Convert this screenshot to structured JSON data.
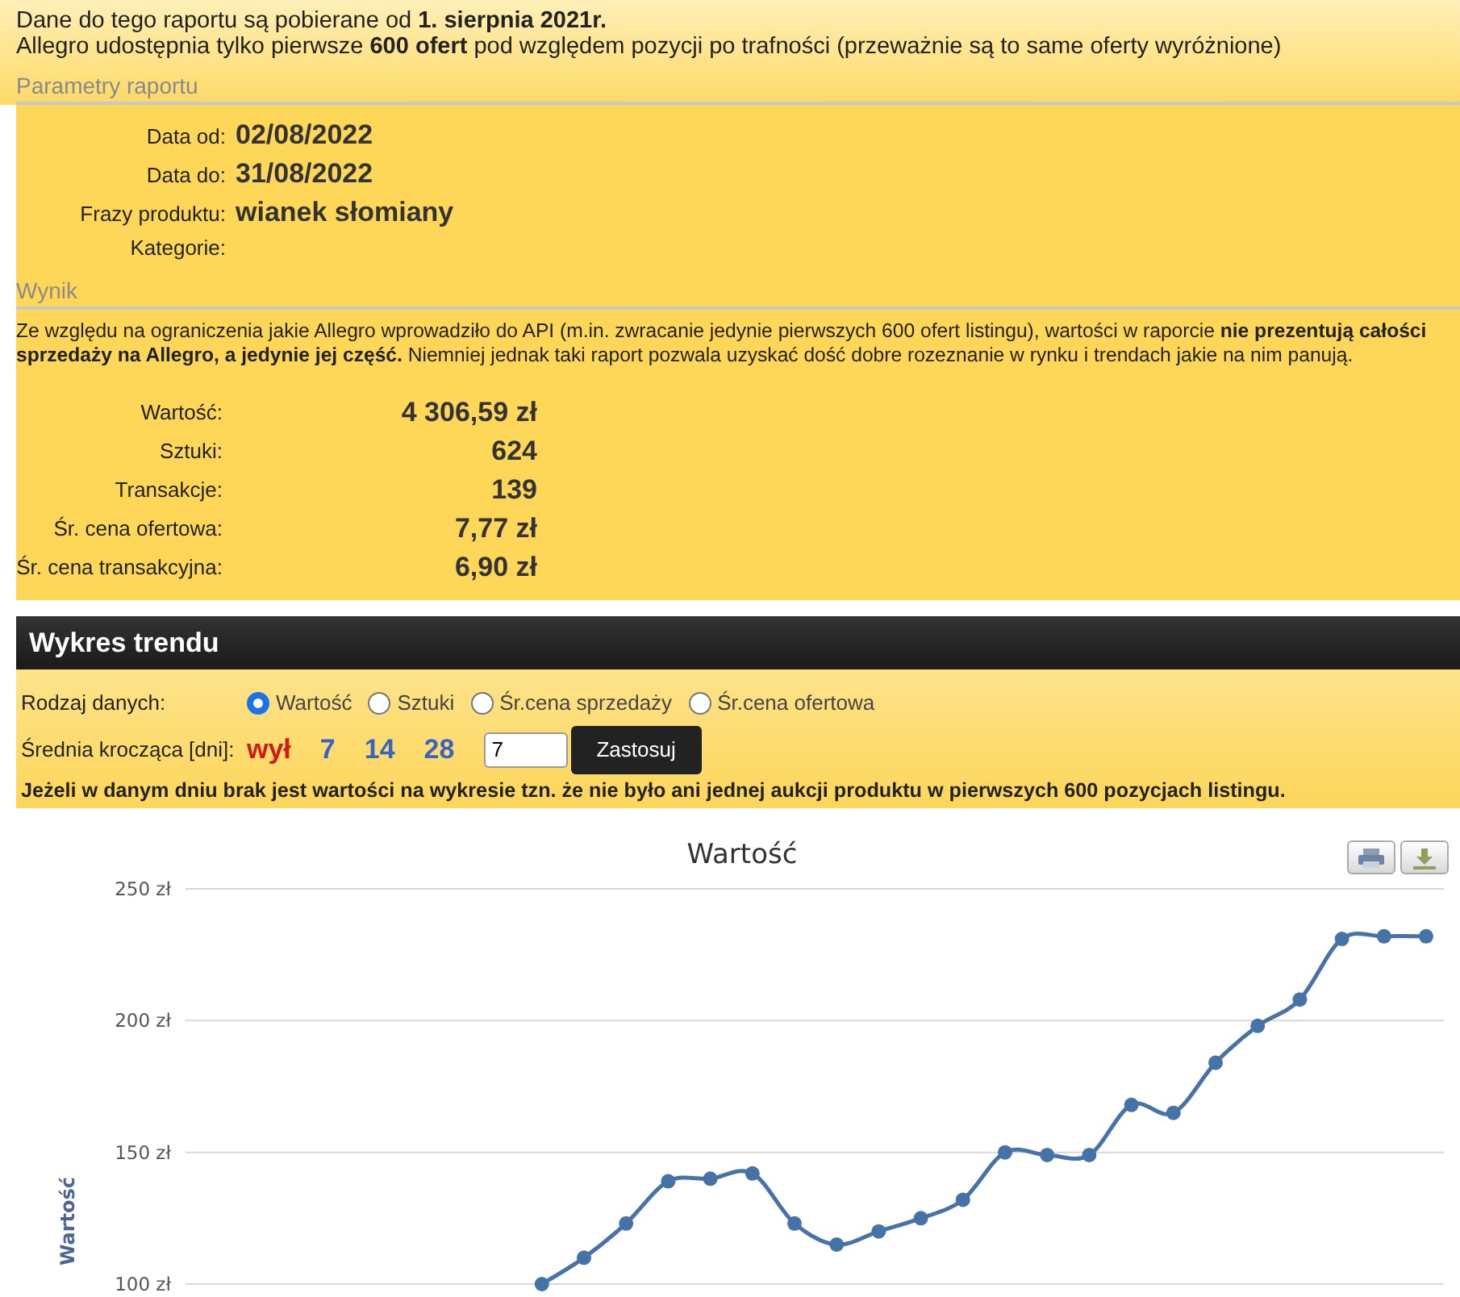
{
  "intro": {
    "lines": [
      "Dane do tego raportu są pobierane od **1. sierpnia 2021r.**",
      "Allegro udostępnia tylko pierwsze **600 ofert** pod względem pozycji po trafności (przeważnie są to same oferty wyróżnione)"
    ]
  },
  "parameters": {
    "heading": "Parametry raportu",
    "rows": [
      {
        "label": "Data od:",
        "value": "02/08/2022"
      },
      {
        "label": "Data do:",
        "value": "31/08/2022"
      },
      {
        "label": "Frazy produktu:",
        "value": "wianek słomiany"
      },
      {
        "label": "Kategorie:"
      }
    ]
  },
  "result": {
    "heading": "Wynik",
    "note": "Ze względu na ograniczenia jakie Allegro wprowadziło do API (m.in. zwracanie jedynie pierwszych 600 ofert listingu), wartości w raporcie **nie prezentują całości sprzedaży na Allegro, a jedynie jej część.** Niemniej jednak taki raport pozwala uzyskać dość dobre rozeznanie w rynku i trendach jakie na nim panują.",
    "stats": [
      {
        "label": "Wartość:",
        "value": "4 306,59 zł"
      },
      {
        "label": "Sztuki:",
        "value": "624"
      },
      {
        "label": "Transakcje:",
        "value": "139"
      },
      {
        "label": "Śr. cena ofertowa:",
        "value": "7,77 zł"
      },
      {
        "label": "Śr. cena transakcyjna:",
        "value": "6,90 zł"
      }
    ]
  },
  "trend": {
    "title": "Wykres trendu",
    "data_type": {
      "label": "Rodzaj danych:",
      "options": [
        {
          "label": "Wartość",
          "selected": true
        },
        {
          "label": "Sztuki",
          "selected": false
        },
        {
          "label": "Śr.cena sprzedaży",
          "selected": false
        },
        {
          "label": "Śr.cena ofertowa",
          "selected": false
        }
      ]
    },
    "moving_average": {
      "label": "Średnia krocząca [dni]:",
      "options": [
        {
          "label": "wył",
          "selected": true
        },
        {
          "label": "7",
          "selected": false
        },
        {
          "label": "14",
          "selected": false
        },
        {
          "label": "28",
          "selected": false
        }
      ],
      "input_value": "7",
      "apply_button": "Zastosuj"
    },
    "note": "Jeżeli w danym dniu brak jest wartości na wykresie tzn. że nie było ani jednej aukcji produktu w pierwszych 600 pozycjach listingu."
  },
  "chart": {
    "chart_data": {
      "type": "line",
      "title": "Wartość",
      "ylabel": "Wartość",
      "ylim": [
        100,
        250
      ],
      "grid": true,
      "yticks": [
        {
          "value": 100,
          "label": "100 zł"
        },
        {
          "value": 150,
          "label": "150 zł"
        },
        {
          "value": 200,
          "label": "200 zł"
        },
        {
          "value": 250,
          "label": "250 zł"
        }
      ],
      "series": [
        {
          "color": "#4572a7",
          "marker": true,
          "values": [
            null,
            null,
            null,
            null,
            null,
            null,
            null,
            null,
            100,
            110,
            123,
            139,
            140,
            142,
            123,
            115,
            120,
            125,
            132,
            150,
            149,
            149,
            168,
            165,
            184,
            198,
            208,
            231,
            232,
            232
          ]
        }
      ]
    }
  }
}
